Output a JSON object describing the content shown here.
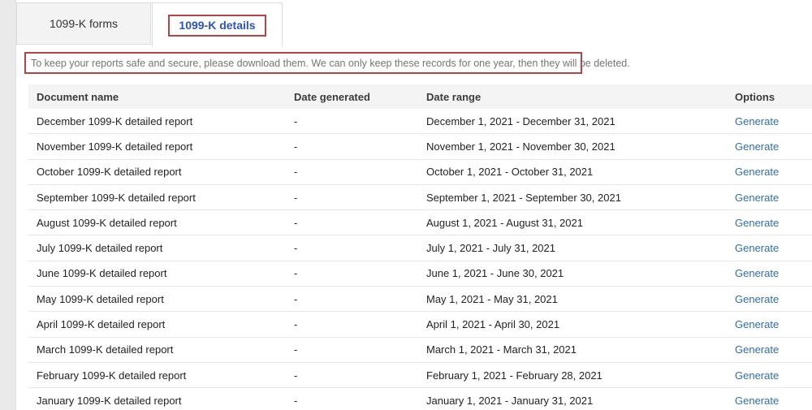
{
  "tabs": [
    {
      "label": "1099-K forms",
      "active": false
    },
    {
      "label": "1099-K details",
      "active": true
    }
  ],
  "notice": "To keep your reports safe and secure, please download them. We can only keep these records for one year, then they will be deleted.",
  "table": {
    "columns": [
      "Document name",
      "Date generated",
      "Date range",
      "Options"
    ],
    "rows": [
      {
        "name": "December 1099-K detailed report",
        "generated": "-",
        "range": "December 1, 2021 - December 31, 2021",
        "action": "Generate"
      },
      {
        "name": "November 1099-K detailed report",
        "generated": "-",
        "range": "November 1, 2021 - November 30, 2021",
        "action": "Generate"
      },
      {
        "name": "October 1099-K detailed report",
        "generated": "-",
        "range": "October 1, 2021 - October 31, 2021",
        "action": "Generate"
      },
      {
        "name": "September 1099-K detailed report",
        "generated": "-",
        "range": "September 1, 2021 - September 30, 2021",
        "action": "Generate"
      },
      {
        "name": "August 1099-K detailed report",
        "generated": "-",
        "range": "August 1, 2021 - August 31, 2021",
        "action": "Generate"
      },
      {
        "name": "July 1099-K detailed report",
        "generated": "-",
        "range": "July 1, 2021 - July 31, 2021",
        "action": "Generate"
      },
      {
        "name": "June 1099-K detailed report",
        "generated": "-",
        "range": "June 1, 2021 - June 30, 2021",
        "action": "Generate"
      },
      {
        "name": "May 1099-K detailed report",
        "generated": "-",
        "range": "May 1, 2021 - May 31, 2021",
        "action": "Generate"
      },
      {
        "name": "April 1099-K detailed report",
        "generated": "-",
        "range": "April 1, 2021 - April 30, 2021",
        "action": "Generate"
      },
      {
        "name": "March 1099-K detailed report",
        "generated": "-",
        "range": "March 1, 2021 - March 31, 2021",
        "action": "Generate"
      },
      {
        "name": "February 1099-K detailed report",
        "generated": "-",
        "range": "February 1, 2021 - February 28, 2021",
        "action": "Generate"
      },
      {
        "name": "January 1099-K detailed report",
        "generated": "-",
        "range": "January 1, 2021 - January 31, 2021",
        "action": "Generate"
      }
    ]
  },
  "colors": {
    "active_tab_blue": "#2b52c4",
    "link_blue": "#2f6fad",
    "annotation_red": "#b94242",
    "header_gray": "#f4f4f4",
    "inactive_tab_gray": "#f3f3f3"
  }
}
